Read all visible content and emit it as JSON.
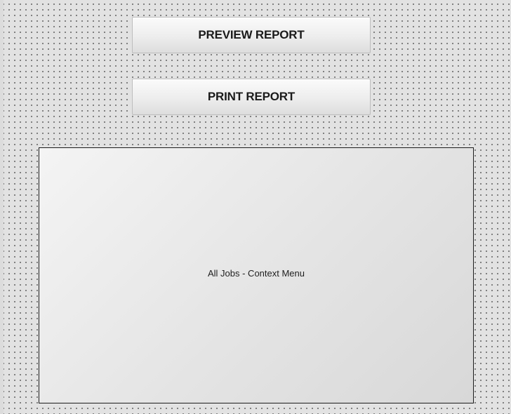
{
  "buttons": {
    "preview_label": "PREVIEW REPORT",
    "print_label": "PRINT REPORT"
  },
  "context_area": {
    "label": "All Jobs - Context Menu"
  },
  "colors": {
    "canvas_background": "#e2e2e2",
    "grid_dot": "#5a5a5a",
    "panel_border": "#1c1c1c",
    "button_border": "#bdbdbd"
  }
}
